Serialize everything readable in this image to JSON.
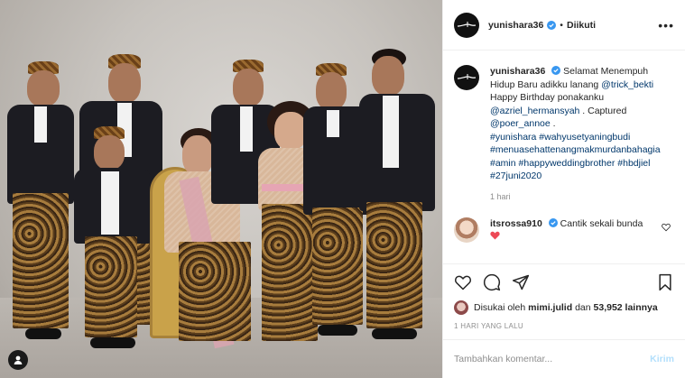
{
  "photo": {
    "alt_icon": "user-tag-icon"
  },
  "header": {
    "username": "yunishara36",
    "separator": "•",
    "follow_label": "Diikuti",
    "more_label": "•••"
  },
  "caption": {
    "username": "yunishara36",
    "text_plain_1": "Selamat Menempuh Hidup Baru adikku lanang",
    "mention_1": "@trick_bekti",
    "text_plain_2": "Happy Birthday ponakanku",
    "mention_2": "@azriel_hermansyah",
    "text_plain_3": ". Captured",
    "mention_3": "@poer_annoe",
    "text_plain_4": ".",
    "hashtags_1": "#yunishara #wahyusetyaningbudi",
    "hashtags_2": "#menuasehattenangmakmurdanbahagia",
    "hashtags_3": "#amin #happyweddingbrother",
    "hashtags_4": "#hbdjiel #27juni2020",
    "time": "1 hari"
  },
  "comment": {
    "username": "itsrossa910",
    "text": "Cantik sekali bunda"
  },
  "likes": {
    "prefix": "Disukai oleh",
    "user": "mimi.julid",
    "middle": "dan",
    "count": "53,952 lainnya"
  },
  "post_time": "1 HARI YANG LALU",
  "add_comment": {
    "placeholder": "Tambahkan komentar...",
    "send_label": "Kirim"
  },
  "colors": {
    "link": "#00376b",
    "verified": "#3897f0",
    "heart": "#ed4956",
    "send_disabled": "#b2dffc"
  }
}
